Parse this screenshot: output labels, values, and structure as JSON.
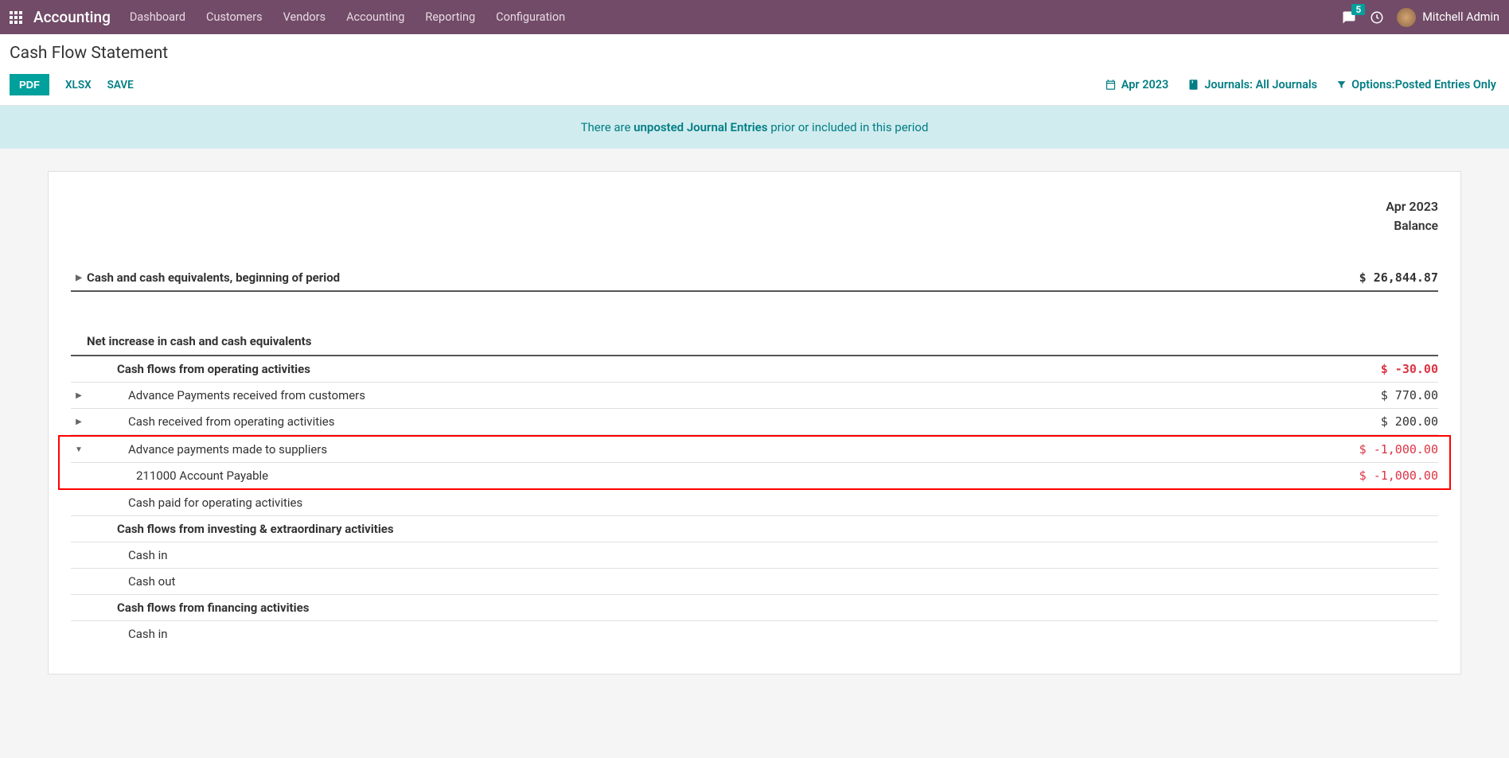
{
  "nav": {
    "brand": "Accounting",
    "items": [
      "Dashboard",
      "Customers",
      "Vendors",
      "Accounting",
      "Reporting",
      "Configuration"
    ],
    "badge_count": "5",
    "username": "Mitchell Admin"
  },
  "control_panel": {
    "title": "Cash Flow Statement",
    "btn_pdf": "PDF",
    "btn_xlsx": "XLSX",
    "btn_save": "SAVE",
    "filter_date": "Apr 2023",
    "filter_journals": "Journals: All Journals",
    "filter_options": "Options:Posted Entries Only"
  },
  "alert": {
    "before": "There are ",
    "link": "unposted Journal Entries",
    "after": " prior or included in this period"
  },
  "report": {
    "period": "Apr 2023",
    "balance_label": "Balance",
    "rows": [
      {
        "label": "Cash and cash equivalents, beginning of period",
        "value": "$ 26,844.87"
      },
      {
        "label": "Net increase in cash and cash equivalents"
      },
      {
        "label": "Cash flows from operating activities",
        "value": "$ -30.00"
      },
      {
        "label": "Advance Payments received from customers",
        "value": "$ 770.00"
      },
      {
        "label": "Cash received from operating activities",
        "value": "$ 200.00"
      },
      {
        "label": "Advance payments made to suppliers",
        "value": "$ -1,000.00"
      },
      {
        "label": "211000 Account Payable",
        "value": "$ -1,000.00"
      },
      {
        "label": "Cash paid for operating activities"
      },
      {
        "label": "Cash flows from investing & extraordinary activities"
      },
      {
        "label": "Cash in"
      },
      {
        "label": "Cash out"
      },
      {
        "label": "Cash flows from financing activities"
      },
      {
        "label": "Cash in"
      }
    ]
  }
}
